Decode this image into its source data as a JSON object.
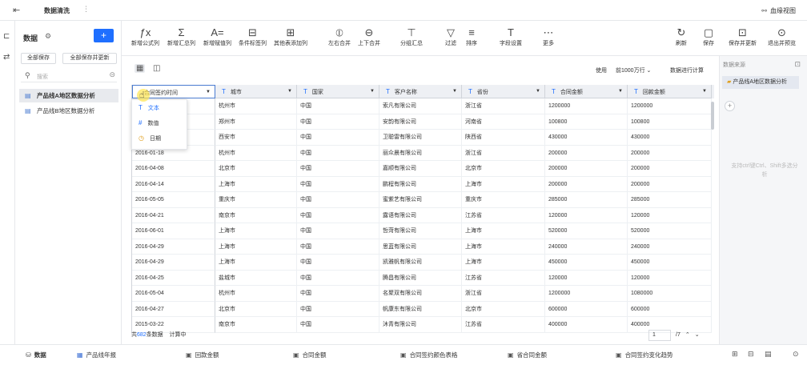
{
  "app": {
    "title": "数据清洗",
    "lineage_label": "血缘视图"
  },
  "left_panel": {
    "title": "数据",
    "save_all": "全部保存",
    "save_all_update": "全部保存并更新",
    "search_placeholder": "搜索",
    "datasets": [
      {
        "name": "产品线A地区数据分析",
        "active": true
      },
      {
        "name": "产品线B地区数据分析",
        "active": false
      }
    ]
  },
  "toolbar": {
    "items": [
      {
        "label": "新增公式列",
        "icon": "formula-icon",
        "glyph": "ƒx"
      },
      {
        "label": "新增汇总列",
        "icon": "sum-icon",
        "glyph": "Σ"
      },
      {
        "label": "新增赋值列",
        "icon": "assign-icon",
        "glyph": "A="
      },
      {
        "label": "条件标签列",
        "icon": "tag-icon",
        "glyph": "⊟"
      },
      {
        "label": "其他表添加列",
        "icon": "add-column-icon",
        "glyph": "⊞"
      },
      {
        "label": "左右合并",
        "icon": "merge-horizontal-icon",
        "glyph": "⦶"
      },
      {
        "label": "上下合并",
        "icon": "merge-vertical-icon",
        "glyph": "⊖"
      },
      {
        "label": "分组汇总",
        "icon": "group-icon",
        "glyph": "⊤"
      },
      {
        "label": "过滤",
        "icon": "filter-icon",
        "glyph": "▽"
      },
      {
        "label": "排序",
        "icon": "sort-icon",
        "glyph": "≡"
      },
      {
        "label": "字段设置",
        "icon": "field-settings-icon",
        "glyph": "T"
      },
      {
        "label": "更多",
        "icon": "more-icon",
        "glyph": "⋯"
      },
      {
        "label": "刷新",
        "icon": "refresh-icon",
        "glyph": "↻"
      },
      {
        "label": "保存",
        "icon": "save-icon",
        "glyph": "▢"
      },
      {
        "label": "保存并更新",
        "icon": "save-update-icon",
        "glyph": "⊡"
      },
      {
        "label": "退出并预览",
        "icon": "exit-preview-icon",
        "glyph": "⊙"
      }
    ]
  },
  "subbar": {
    "use_label": "使用",
    "row_limit": "前1000万行",
    "calc_label": "数据进行计算"
  },
  "table": {
    "columns": [
      "合同签约时间",
      "城市",
      "国家",
      "客户名称",
      "省份",
      "合同金额",
      "回款金额"
    ],
    "rows": [
      [
        "",
        "杭州市",
        "中国",
        "索凡有限公司",
        "浙江省",
        "1200000",
        "1200000"
      ],
      [
        "",
        "郑州市",
        "中国",
        "安韵有限公司",
        "河南省",
        "100800",
        "100800"
      ],
      [
        "",
        "西安市",
        "中国",
        "卫聪雷有限公司",
        "陕西省",
        "430000",
        "430000"
      ],
      [
        "2016-01-18",
        "杭州市",
        "中国",
        "丽众晨有限公司",
        "浙江省",
        "200000",
        "200000"
      ],
      [
        "2016-04-08",
        "北京市",
        "中国",
        "嘉顺有限公司",
        "北京市",
        "200000",
        "200000"
      ],
      [
        "2016-04-14",
        "上海市",
        "中国",
        "鹏程有限公司",
        "上海市",
        "200000",
        "200000"
      ],
      [
        "2016-05-05",
        "重庆市",
        "中国",
        "蜜紫艺有限公司",
        "重庆市",
        "285000",
        "285000"
      ],
      [
        "2016-04-21",
        "南京市",
        "中国",
        "露语有限公司",
        "江苏省",
        "120000",
        "120000"
      ],
      [
        "2016-06-01",
        "上海市",
        "中国",
        "哲菏有限公司",
        "上海市",
        "520000",
        "520000"
      ],
      [
        "2016-04-29",
        "上海市",
        "中国",
        "思蓝有限公司",
        "上海市",
        "240000",
        "240000"
      ],
      [
        "2016-04-29",
        "上海市",
        "中国",
        "凯雅帆有限公司",
        "上海市",
        "450000",
        "450000"
      ],
      [
        "2016-04-25",
        "盐城市",
        "中国",
        "腾昌有限公司",
        "江苏省",
        "120000",
        "120000"
      ],
      [
        "2016-05-04",
        "杭州市",
        "中国",
        "名聚双有限公司",
        "浙江省",
        "1200000",
        "1080000"
      ],
      [
        "2016-04-27",
        "北京市",
        "中国",
        "帆康东有限公司",
        "北京市",
        "600000",
        "600000"
      ],
      [
        "2015-03-22",
        "南京市",
        "中国",
        "沐青有限公司",
        "江苏省",
        "400000",
        "400000"
      ]
    ]
  },
  "type_popup": {
    "items": [
      "文本",
      "数值",
      "日期"
    ]
  },
  "footer": {
    "prefix": "共",
    "count": "682",
    "suffix": "条数据",
    "calc": "计算中",
    "page": "1",
    "total_pages": "/7"
  },
  "right_panel": {
    "label": "数据来源",
    "source": "产品线A地区数据分析",
    "hint": "支持ctrl键Ctrl、Shift多选分析"
  },
  "bottom_tabs": [
    {
      "label": "数据",
      "icon": "database-icon",
      "active": true
    },
    {
      "label": "产品线年报",
      "icon": "report-icon",
      "active": false
    },
    {
      "label": "回款金额",
      "icon": "chart-icon",
      "active": false
    },
    {
      "label": "合同金额",
      "icon": "chart-icon",
      "active": false
    },
    {
      "label": "合同签约颜色表格",
      "icon": "chart-icon",
      "active": false
    },
    {
      "label": "省合同金额",
      "icon": "chart-icon",
      "active": false
    },
    {
      "label": "合同签约变化趋势",
      "icon": "chart-icon",
      "active": false
    }
  ]
}
